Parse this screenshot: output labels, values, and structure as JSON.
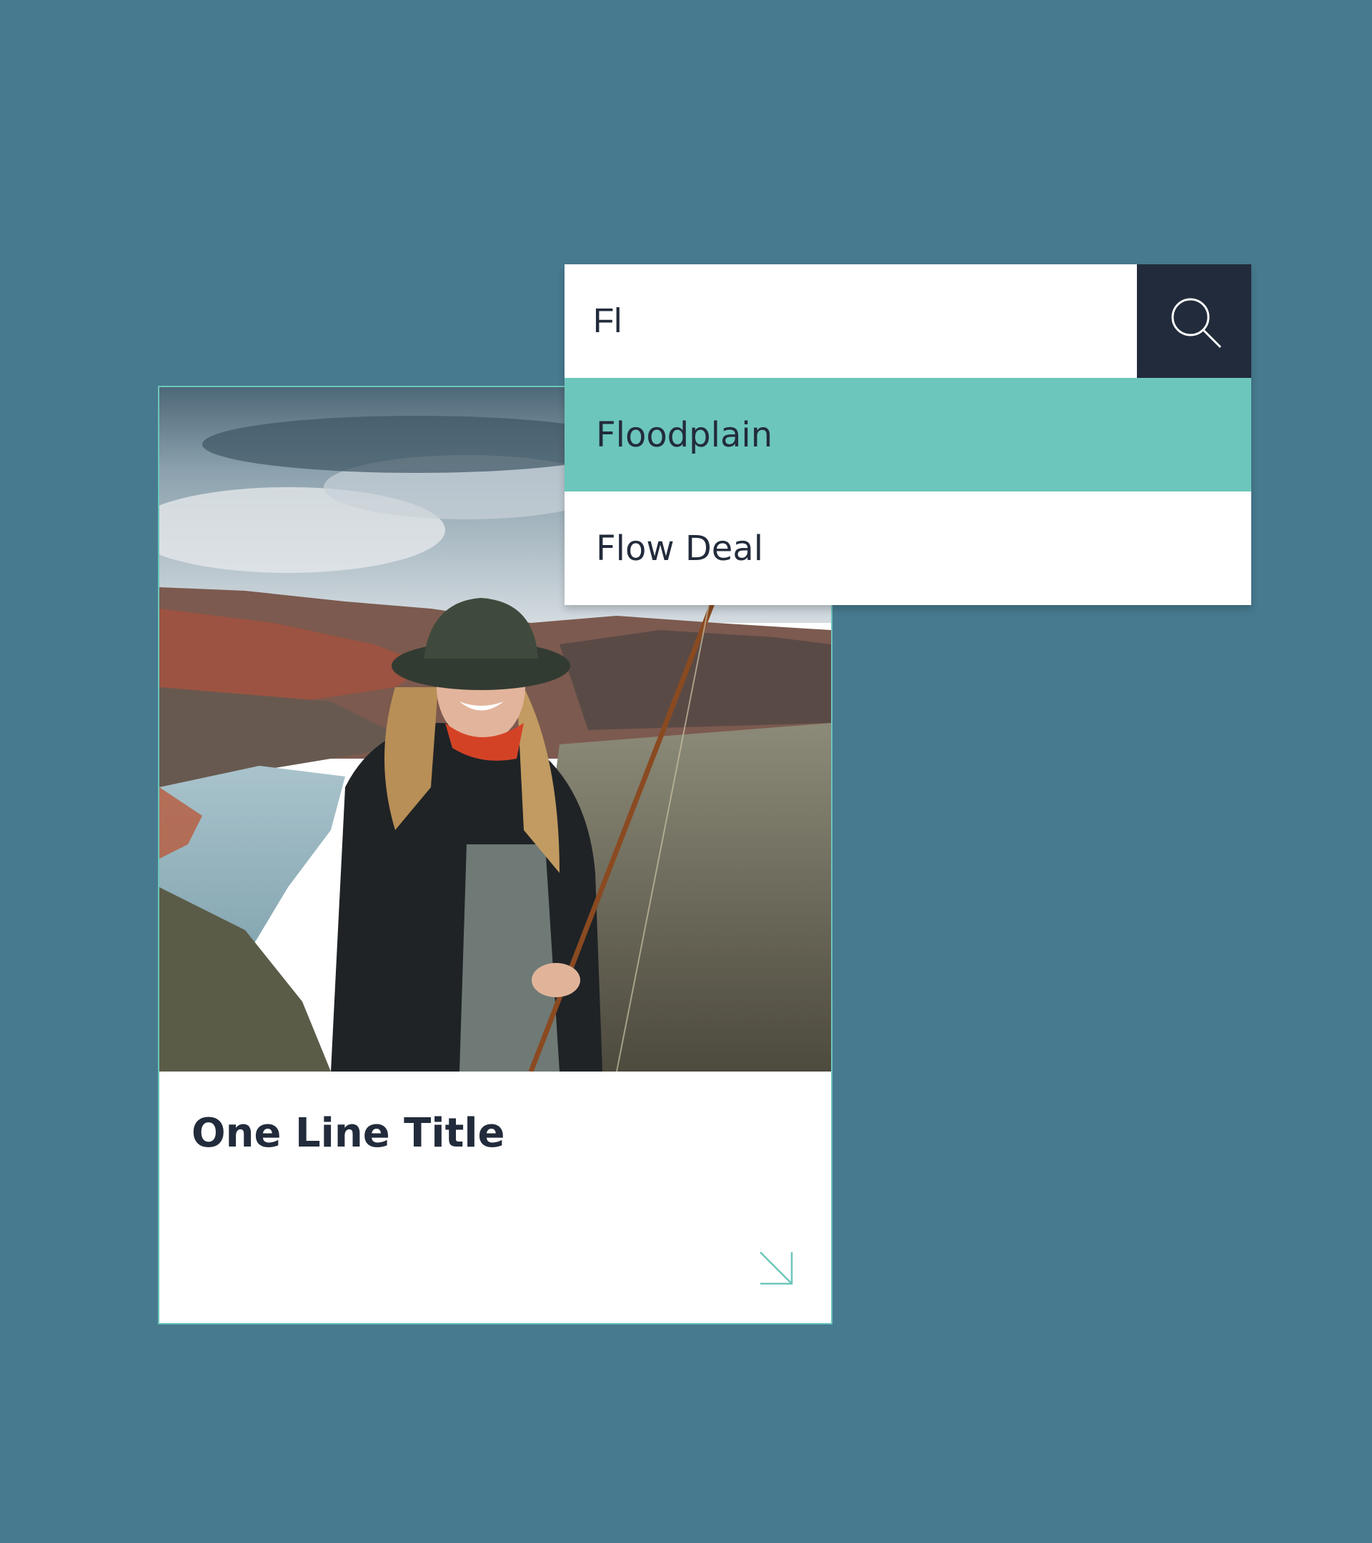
{
  "search": {
    "value": "Fl",
    "button_icon": "search-icon",
    "suggestions": [
      {
        "label": "Floodplain",
        "highlighted": true
      },
      {
        "label": "Flow Deal",
        "highlighted": false
      }
    ]
  },
  "card": {
    "title": "One Line Title",
    "arrow_icon": "arrow-down-right-icon"
  },
  "colors": {
    "background": "#477a8f",
    "accent": "#6cc6bb",
    "dark": "#222b3b",
    "surface": "#ffffff"
  }
}
